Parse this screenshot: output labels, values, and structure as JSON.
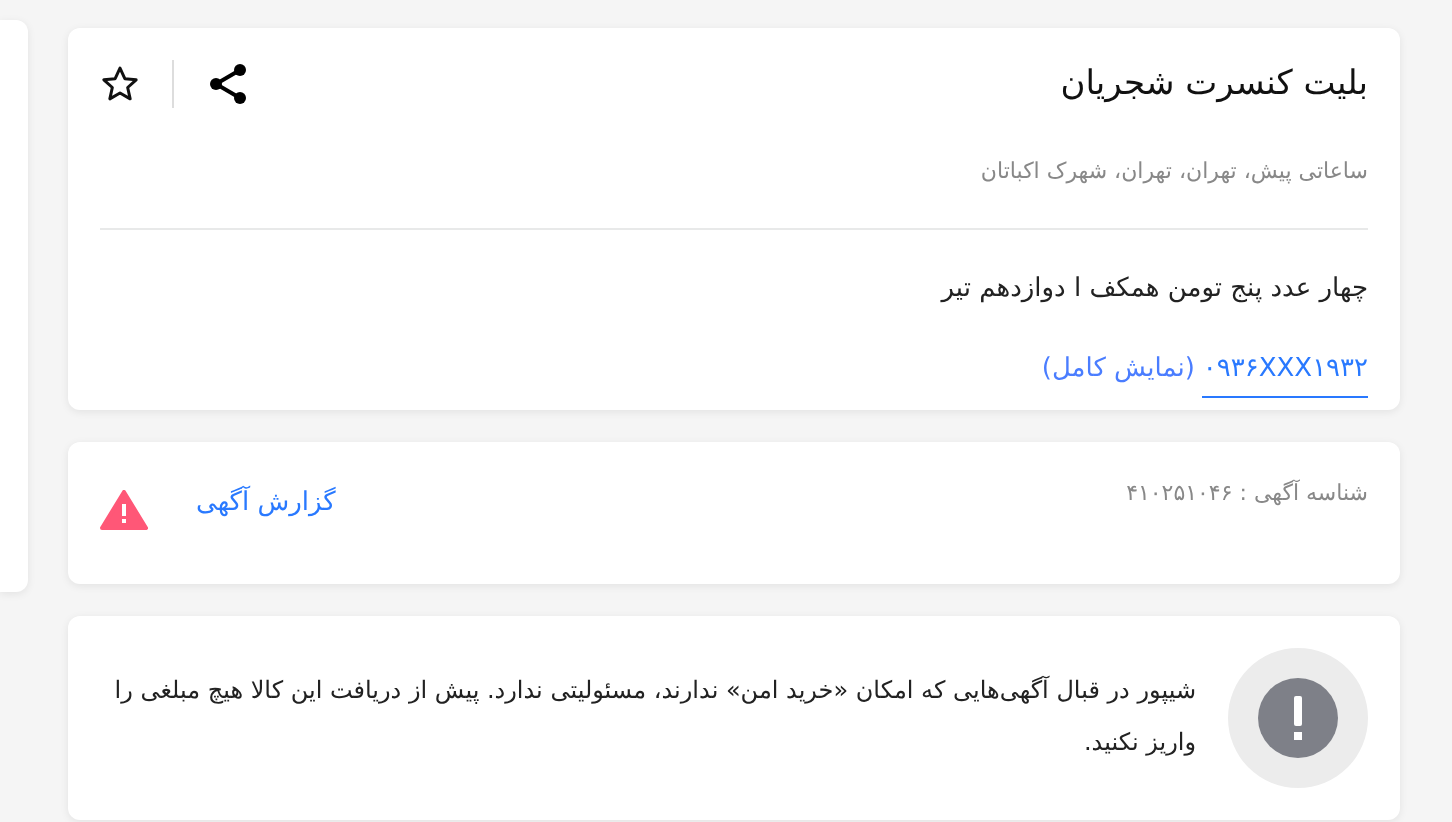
{
  "listing": {
    "title": "بلیت کنسرت شجریان",
    "subtitle": "ساعاتی پیش، تهران، تهران، شهرک اکباتان",
    "description": "چهار عدد پنج تومن همکف ا دوازدهم تیر",
    "phone": "۰۹۳۶XXX۱۹۳۲",
    "phone_reveal": "(نمایش کامل)",
    "bookmarked": false
  },
  "report": {
    "ad_id": "شناسه آگهی : ۴۱۰۲۵۱۰۴۶",
    "link": "گزارش آگهی"
  },
  "notice": {
    "text": "شیپور در قبال آگهی‌هایی که امکان «خرید امن» ندارند، مسئولیتی ندارد. پیش از دریافت این کالا هیچ مبلغی را واریز نکنید."
  }
}
